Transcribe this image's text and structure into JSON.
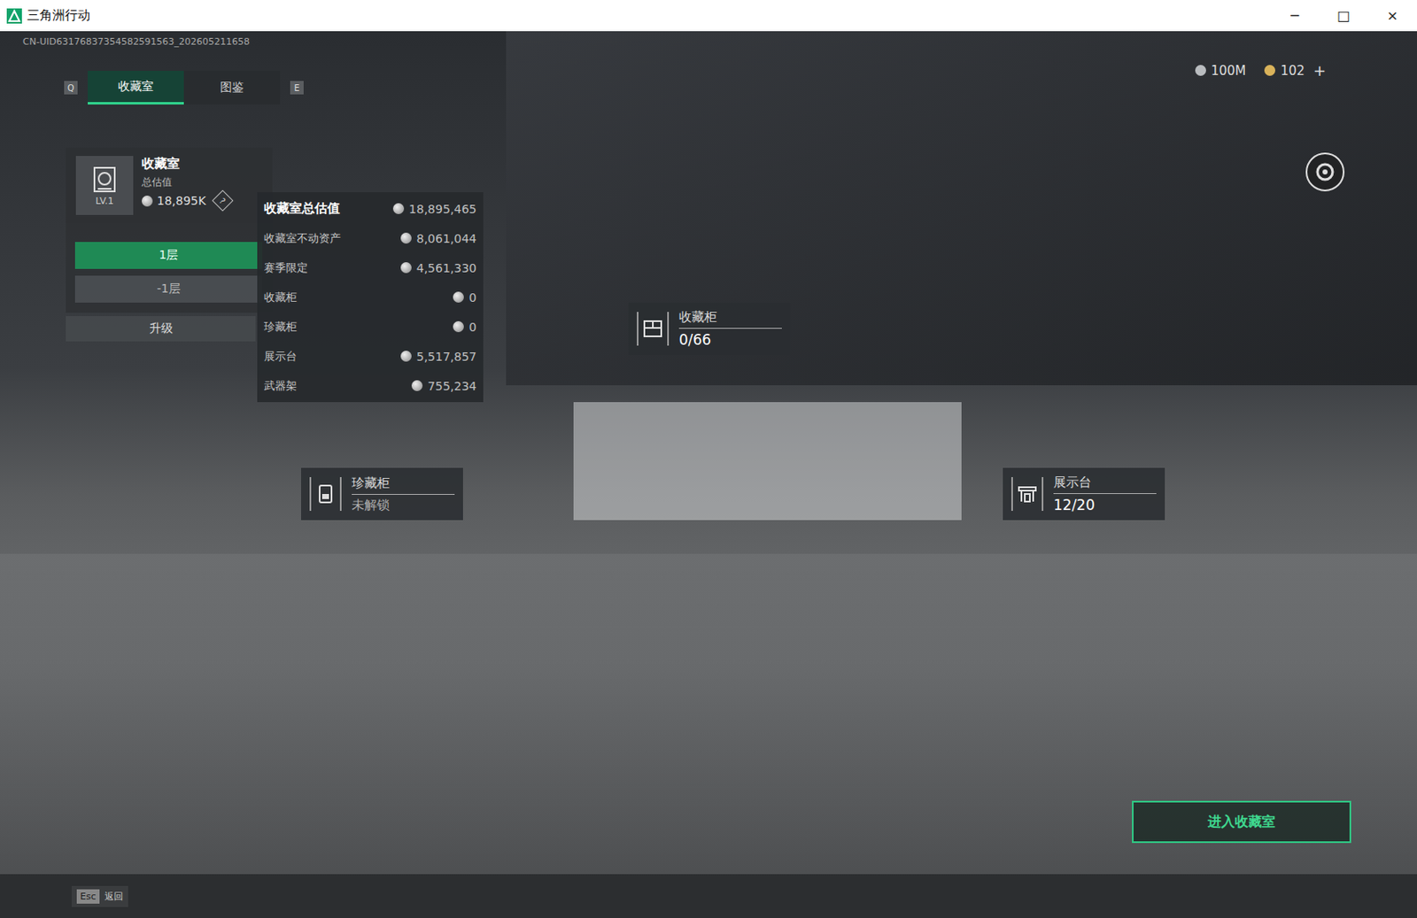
{
  "window": {
    "title": "三角洲行动",
    "controls": [
      "─",
      "□",
      "×"
    ]
  },
  "uid": "CN-UID63176837354582591563_202605211658",
  "tabs": {
    "prev_key": "Q",
    "next_key": "E",
    "items": [
      {
        "label": "收藏室",
        "selected": true
      },
      {
        "label": "图鉴",
        "selected": false
      }
    ]
  },
  "currency": [
    {
      "amount": "100M",
      "action": "",
      "color": "#b9bcbf"
    },
    {
      "amount": "102",
      "action": "+",
      "color": "#d9b25a"
    }
  ],
  "summary": {
    "title": "收藏室",
    "level": "LV.1",
    "value_label": "总估值",
    "value": "18,895K",
    "help": "?"
  },
  "floors": [
    {
      "label": "1层",
      "selected": true
    },
    {
      "label": "-1层",
      "selected": false
    }
  ],
  "upgrade": "升级",
  "breakdown": {
    "title": "收藏室总估值",
    "total": "18,895,465",
    "rows": [
      {
        "label": "收藏室不动资产",
        "value": "8,061,044"
      },
      {
        "label": "赛季限定",
        "value": "4,561,330"
      },
      {
        "label": "收藏柜",
        "value": "0"
      },
      {
        "label": "珍藏柜",
        "value": "0"
      },
      {
        "label": "展示台",
        "value": "5,517,857"
      },
      {
        "label": "武器架",
        "value": "755,234"
      }
    ]
  },
  "markers": [
    {
      "name": "收藏柜",
      "status": "0/66",
      "locked": false
    },
    {
      "name": "珍藏柜",
      "status": "未解锁",
      "locked": true
    },
    {
      "name": "展示台",
      "status": "12/20",
      "locked": false
    }
  ],
  "enter_button": "进入收藏室",
  "footer": {
    "key": "Esc",
    "label": "返回"
  }
}
